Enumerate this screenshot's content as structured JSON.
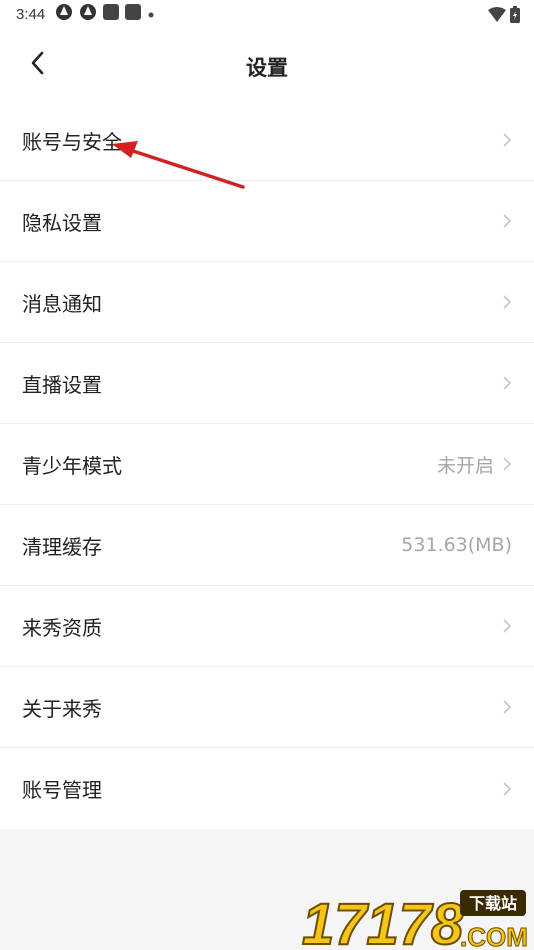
{
  "status_bar": {
    "time": "3:44",
    "icons": [
      "notification-icon",
      "notification-icon",
      "app-icon",
      "app-icon",
      "dot-icon"
    ],
    "right_icons": [
      "wifi-icon",
      "battery-icon"
    ]
  },
  "header": {
    "title": "设置",
    "back_icon": "chevron-left-icon"
  },
  "settings": [
    {
      "label": "账号与安全",
      "value": ""
    },
    {
      "label": "隐私设置",
      "value": ""
    },
    {
      "label": "消息通知",
      "value": ""
    },
    {
      "label": "直播设置",
      "value": ""
    },
    {
      "label": "青少年模式",
      "value": "未开启"
    },
    {
      "label": "清理缓存",
      "value": "531.63(MB)"
    },
    {
      "label": "来秀资质",
      "value": ""
    },
    {
      "label": "关于来秀",
      "value": ""
    },
    {
      "label": "账号管理",
      "value": ""
    }
  ],
  "watermark": {
    "number": "17178",
    "tag": "下载站",
    "suffix": ".COM"
  },
  "colors": {
    "background": "#f5f5f5",
    "card": "#ffffff",
    "text": "#222222",
    "secondary_text": "#a6a6a6",
    "arrow": "#d42020",
    "watermark_yellow": "#f5c518"
  }
}
